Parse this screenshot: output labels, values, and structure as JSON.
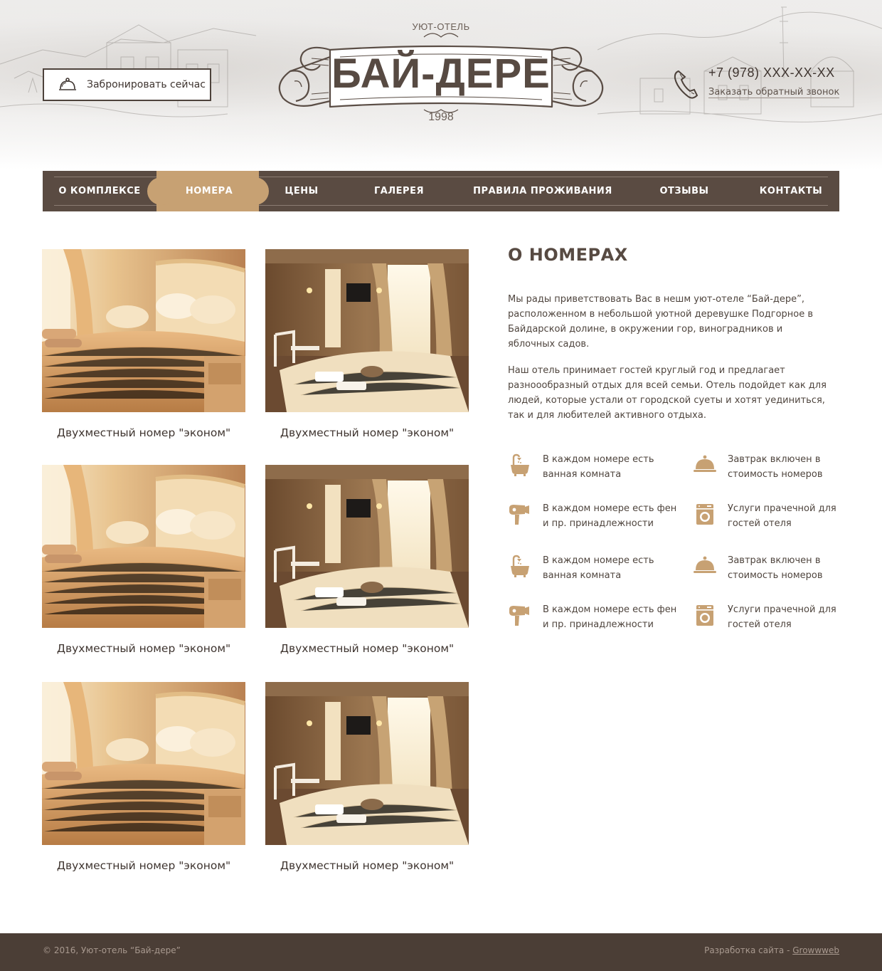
{
  "header": {
    "book_button": "Забронировать сейчас",
    "logo_subtitle": "УЮТ-ОТЕЛЬ",
    "logo_name": "БАЙ-ДЕРЕ",
    "logo_year": "1998",
    "phone": "+7 (978) XXX-XX-XX",
    "callback": "Заказать обратный звонок"
  },
  "nav": {
    "items": [
      "О КОМПЛЕКСЕ",
      "НОМЕРА",
      "ЦЕНЫ",
      "ГАЛЕРЕЯ",
      "ПРАВИЛА ПРОЖИВАНИЯ",
      "ОТЗЫВЫ",
      "КОНТАКТЫ"
    ],
    "active": "НОМЕРА"
  },
  "rooms": [
    {
      "caption": "Двухместный номер \"эконом\""
    },
    {
      "caption": "Двухместный номер \"эконом\""
    },
    {
      "caption": "Двухместный номер \"эконом\""
    },
    {
      "caption": "Двухместный номер \"эконом\""
    },
    {
      "caption": "Двухместный номер \"эконом\""
    },
    {
      "caption": "Двухместный номер \"эконом\""
    }
  ],
  "about": {
    "title": "О НОМЕРАХ",
    "p1": "Мы рады приветствовать Вас в нешм уют-отеле “Бай-дере”, расположенном в небольшой уютной деревушке Подгорное в Байдарской долине, в окружении гор, виноградников и яблочных садов.",
    "p2": "Наш отель принимает гостей круглый год и предлагает разноообразный отдых для всей семьи. Отель подойдет как для людей, которые устали от городской суеты и хотят уединиться, так и для любителей активного отдыха.",
    "features": [
      {
        "icon": "bathtub-icon",
        "text": "В каждом номере есть ванная комната"
      },
      {
        "icon": "cloche-icon",
        "text": "Завтрак включен в стоимость номеров"
      },
      {
        "icon": "hairdryer-icon",
        "text": "В каждом номере есть фен и пр. принадлежности"
      },
      {
        "icon": "washing-machine-icon",
        "text": "Услуги прачечной для гостей отеля"
      },
      {
        "icon": "bathtub-icon",
        "text": "В каждом номере есть ванная комната"
      },
      {
        "icon": "cloche-icon",
        "text": "Завтрак включен в стоимость номеров"
      },
      {
        "icon": "hairdryer-icon",
        "text": "В каждом номере есть фен и пр. принадлежности"
      },
      {
        "icon": "washing-machine-icon",
        "text": "Услуги прачечной для гостей отеля"
      }
    ]
  },
  "footer": {
    "copyright": "© 2016, Уют-отель “Бай-дере”",
    "dev_prefix": "Разработка сайта - ",
    "dev_link": "Growwweb"
  },
  "colors": {
    "accent": "#c7a173",
    "nav_bg": "#5a4b42",
    "footer_bg": "#4b3e36",
    "text_dark": "#3f3530"
  }
}
